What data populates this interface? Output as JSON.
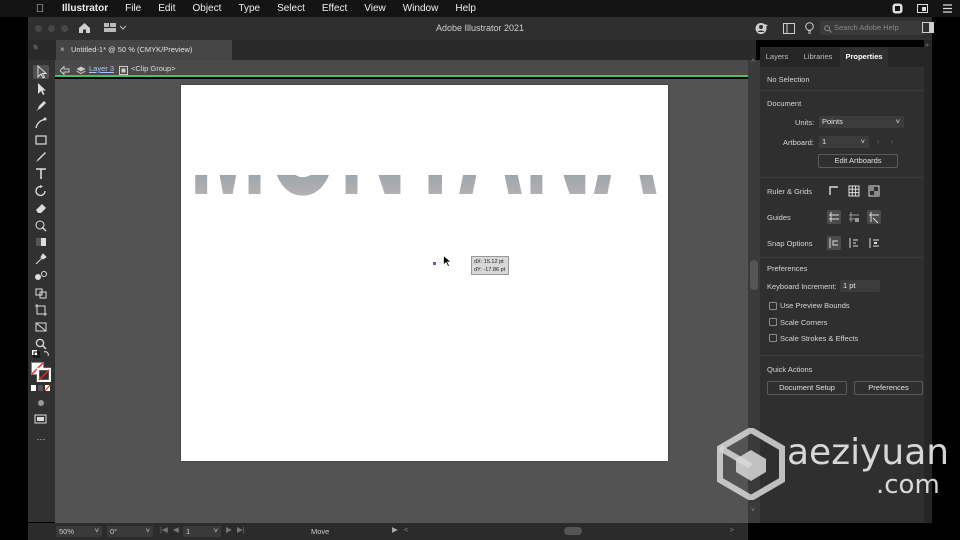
{
  "menubar": {
    "app_name": "Illustrator",
    "items": [
      "File",
      "Edit",
      "Object",
      "Type",
      "Select",
      "Effect",
      "View",
      "Window",
      "Help"
    ]
  },
  "appbar": {
    "title": "Adobe Illustrator 2021",
    "search_placeholder": "Search Adobe Help"
  },
  "document": {
    "tab_label": "Untitled-1* @ 50 % (CMYK/Preview)",
    "breadcrumb_layer": "Layer 3",
    "breadcrumb_group": "<Clip Group>"
  },
  "artwork": {
    "text": "MONTANA",
    "tooltip_dx": "dX: 15.12 pt",
    "tooltip_dy": "dY: -17.86 pt"
  },
  "status": {
    "zoom": "50%",
    "rotation": "0°",
    "artboard": "1",
    "tool": "Move"
  },
  "panel": {
    "tabs": [
      "Layers",
      "Libraries",
      "Properties"
    ],
    "selection": "No Selection",
    "document_heading": "Document",
    "units_label": "Units:",
    "units_value": "Points",
    "artboard_label": "Artboard:",
    "artboard_value": "1",
    "edit_artboards": "Edit Artboards",
    "ruler_grids": "Ruler & Grids",
    "guides": "Guides",
    "snap_options": "Snap Options",
    "preferences_heading": "Preferences",
    "keyboard_increment_label": "Keyboard Increment:",
    "keyboard_increment_value": "1 pt",
    "use_preview_bounds": "Use Preview Bounds",
    "scale_corners": "Scale Corners",
    "scale_strokes": "Scale Strokes & Effects",
    "quick_actions": "Quick Actions",
    "document_setup": "Document Setup",
    "preferences_button": "Preferences"
  },
  "watermark": {
    "line1": "aeziyuan",
    "line2": ".com"
  },
  "colors": {
    "accent_green": "#46c16a",
    "panel_bg": "#2f2f2f",
    "canvas_bg": "#535353"
  }
}
